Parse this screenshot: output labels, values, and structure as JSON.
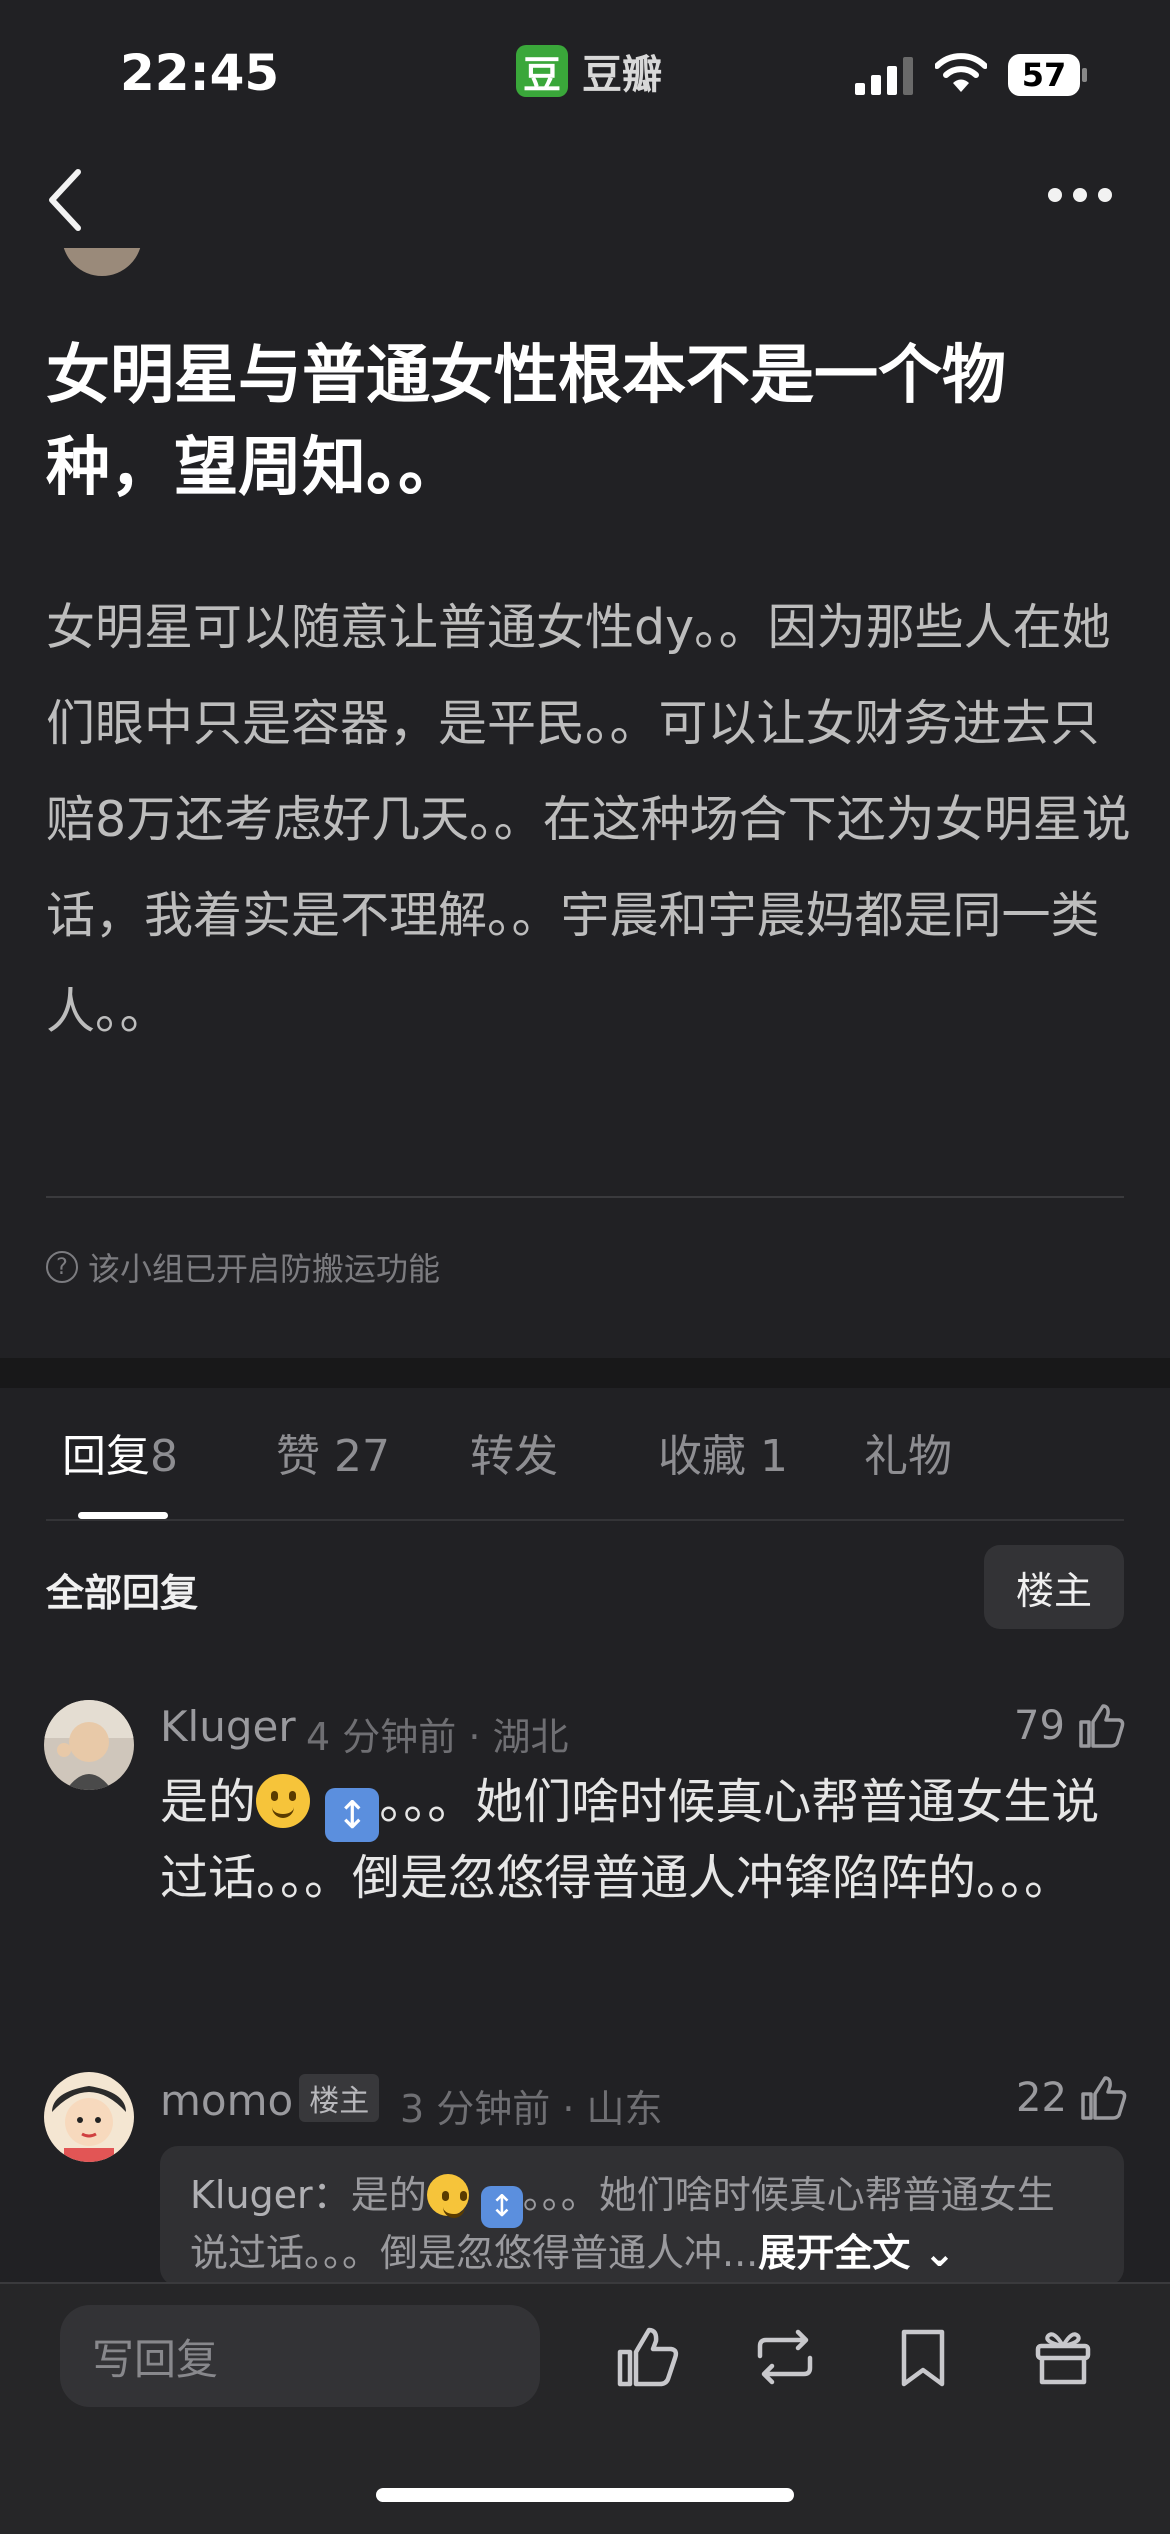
{
  "status_bar": {
    "time": "22:45",
    "app_name": "豆瓣",
    "app_logo_char": "豆",
    "battery": "57"
  },
  "post": {
    "title": "女明星与普通女性根本不是一个物种，望周知。。",
    "body": "女明星可以随意让普通女性dy。。因为那些人在她们眼中只是容器，是平民。。可以让女财务进去只赔8万还考虑好几天。。在这种场合下还为女明星说话，我着实是不理解。。宇晨和宇晨妈都是同一类人。。",
    "notice": "该小组已开启防搬运功能"
  },
  "tabs": [
    {
      "label": "回复",
      "count": "8"
    },
    {
      "label": "赞",
      "count": "27"
    },
    {
      "label": "转发",
      "count": ""
    },
    {
      "label": "收藏",
      "count": "1"
    },
    {
      "label": "礼物",
      "count": ""
    }
  ],
  "replies_header": {
    "title": "全部回复",
    "op_button": "楼主"
  },
  "comments": [
    {
      "name": "Kluger",
      "meta": "4 分钟前 · 湖北",
      "likes": "79",
      "text_before": "是的",
      "text_after": "。。。她们啥时候真心帮普通女生说过话。。。倒是忽悠得普通人冲锋陷阵的。。。"
    },
    {
      "name": "momo",
      "tag": "楼主",
      "meta": "3 分钟前 · 山东",
      "likes": "22",
      "quote_author": "Kluger：",
      "quote_before": "是的",
      "quote_after": "。。。她们啥时候真心帮普通女生说过话。。。倒是忽悠得普通人冲...",
      "expand": "展开全文"
    }
  ],
  "bottom_bar": {
    "reply_placeholder": "写回复"
  },
  "colors": {
    "background": "#212124",
    "brand_green": "#3aa73a"
  },
  "icons": [
    "back-icon",
    "more-icon",
    "help-circle-icon",
    "thumbs-up-icon",
    "repost-icon",
    "bookmark-icon",
    "gift-icon"
  ]
}
